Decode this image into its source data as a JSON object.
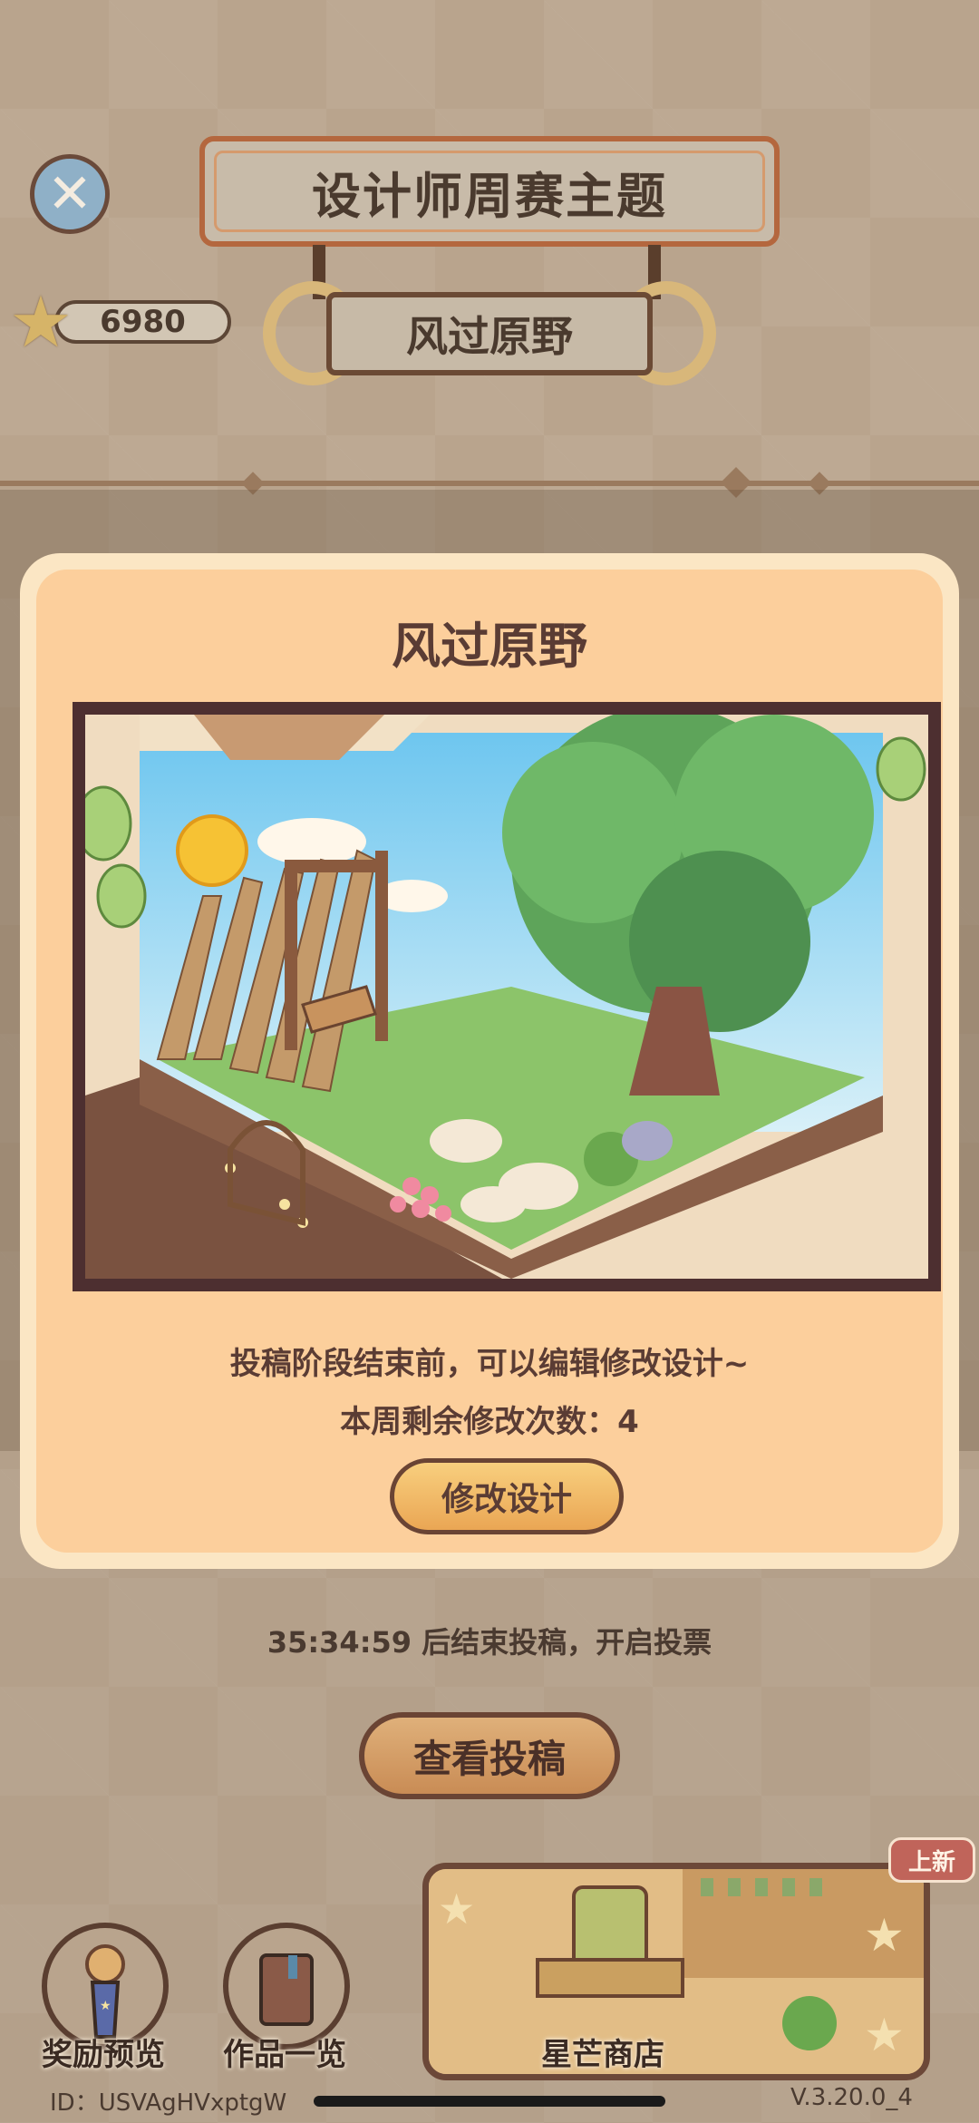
{
  "header": {
    "title": "设计师周赛主题",
    "theme": "风过原野",
    "star_count": "6980"
  },
  "modal": {
    "title": "风过原野",
    "description": "投稿阶段结束前，可以编辑修改设计~",
    "remaining_label": "本周剩余修改次数：4",
    "edit_button": "修改设计"
  },
  "countdown": "35:34:59  后结束投稿，开启投票",
  "view_button": "查看投稿",
  "nav": {
    "rewards": "奖励预览",
    "works": "作品一览",
    "shop": "星芒商店",
    "new_tag": "上新"
  },
  "footer": {
    "id": "ID：USVAgHVxptgW",
    "version": "V.3.20.0_4"
  },
  "colors": {
    "modal_bg": "#fccf9c",
    "accent_brown": "#5a3c34",
    "button_orange": "#eaa654"
  }
}
